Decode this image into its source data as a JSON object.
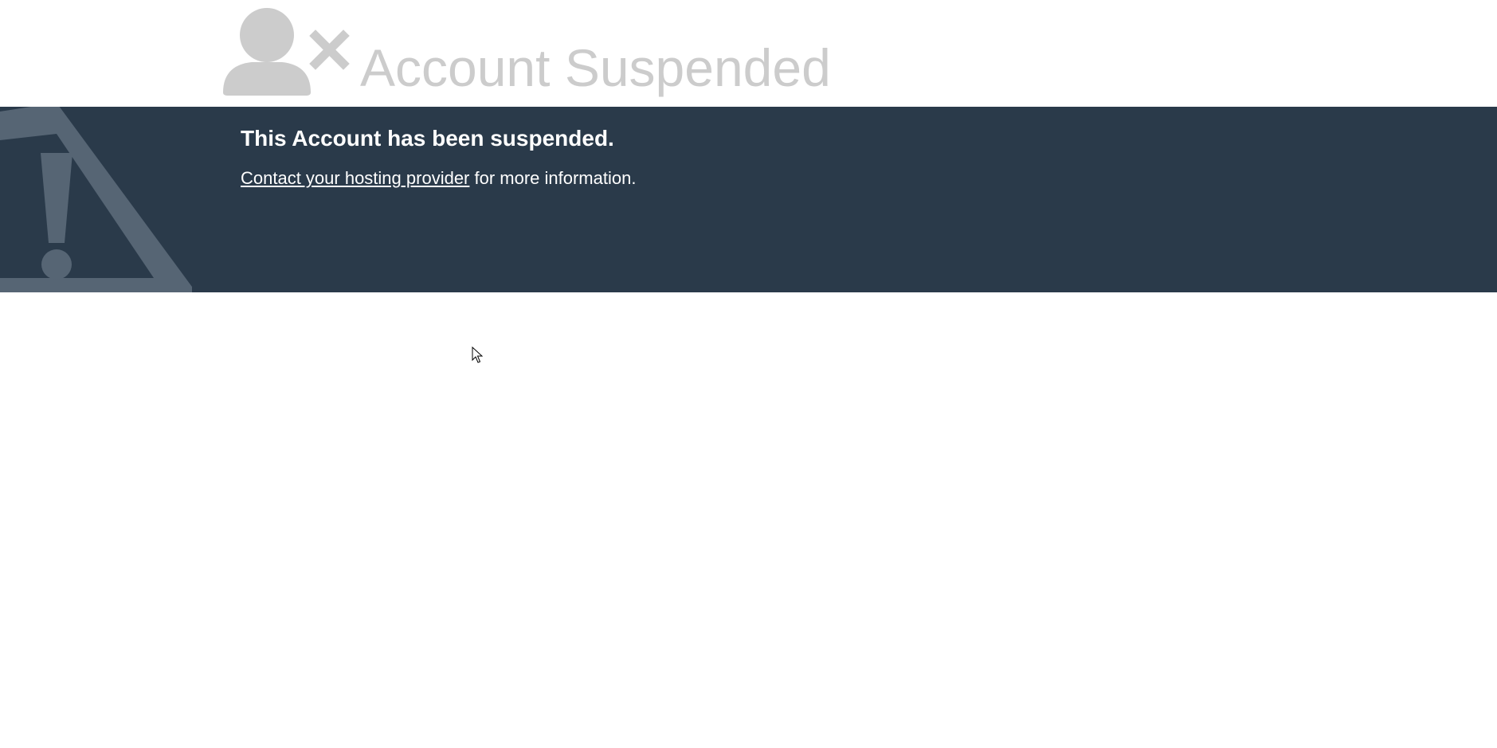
{
  "header": {
    "title": "Account Suspended",
    "icon": "user-times-icon",
    "title_color": "#cccccc"
  },
  "banner": {
    "heading": "This Account has been suspended.",
    "link_text": "Contact your hosting provider",
    "message_rest": " for more information.",
    "background_color": "#2a3a4a",
    "icon": "warning-triangle-icon"
  }
}
